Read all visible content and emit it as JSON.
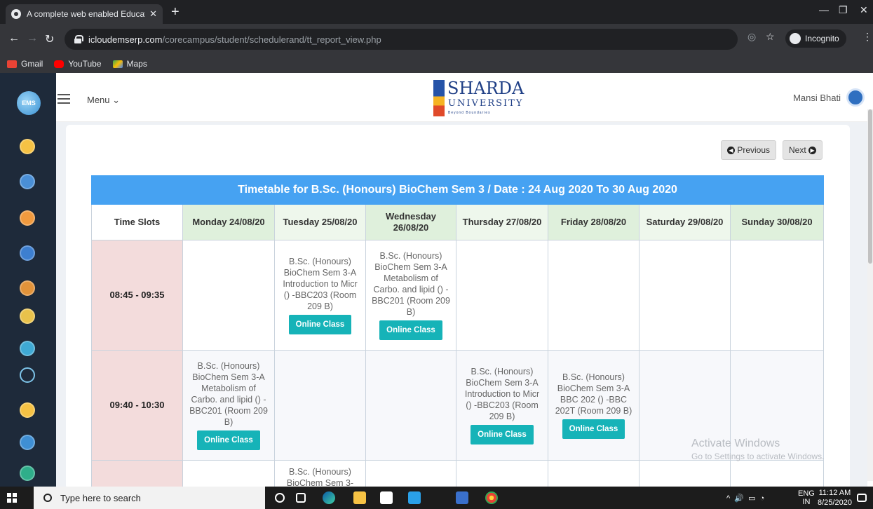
{
  "browser": {
    "tab_title": "A complete web enabled Educati",
    "url_host": "icloudemserp.com",
    "url_path": "/corecampus/student/schedulerand/tt_report_view.php",
    "incognito_label": "Incognito",
    "bookmarks": [
      "Gmail",
      "YouTube",
      "Maps"
    ]
  },
  "header": {
    "menu_label": "Menu",
    "logo_line1": "SHARDA",
    "logo_line2": "UNIVERSITY",
    "logo_tagline": "Beyond Boundaries",
    "user_name": "Mansi Bhati"
  },
  "nav": {
    "previous_label": "Previous",
    "next_label": "Next"
  },
  "timetable": {
    "title": "Timetable for B.Sc. (Honours) BioChem Sem 3 / Date : 24 Aug 2020 To 30 Aug 2020",
    "slot_header": "Time Slots",
    "days": [
      "Monday 24/08/20",
      "Tuesday 25/08/20",
      "Wednesday 26/08/20",
      "Thursday 27/08/20",
      "Friday 28/08/20",
      "Saturday 29/08/20",
      "Sunday 30/08/20"
    ],
    "button_label": "Online Class",
    "rows": [
      {
        "time": "08:45 - 09:35",
        "cells": [
          "",
          "B.Sc. (Honours) BioChem Sem 3-A Introduction to Micr () -BBC203 (Room 209 B)",
          "B.Sc. (Honours) BioChem Sem 3-A Metabolism of Carbo. and lipid () -BBC201 (Room 209 B)",
          "",
          "",
          "",
          ""
        ]
      },
      {
        "time": "09:40 - 10:30",
        "cells": [
          "B.Sc. (Honours) BioChem Sem 3-A Metabolism of Carbo. and lipid () -BBC201 (Room 209 B)",
          "",
          "",
          "B.Sc. (Honours) BioChem Sem 3-A Introduction to Micr () -BBC203 (Room 209 B)",
          "B.Sc. (Honours) BioChem Sem 3-A BBC 202 () -BBC 202T (Room 209 B)",
          "",
          ""
        ]
      },
      {
        "time": "",
        "cells": [
          "",
          "B.Sc. (Honours) BioChem Sem 3-",
          "",
          "",
          "",
          "",
          ""
        ]
      }
    ]
  },
  "watermark": {
    "title": "Activate Windows",
    "subtitle": "Go to Settings to activate Windows."
  },
  "taskbar": {
    "search_placeholder": "Type here to search",
    "lang": "ENG",
    "region": "IN",
    "time": "11:12 AM",
    "date": "8/25/2020"
  },
  "colors": {
    "title_bar": "#46a2f2",
    "time_cell": "#f3dcdc",
    "day_header": "#dff0dc",
    "online_button": "#16b3b8"
  }
}
